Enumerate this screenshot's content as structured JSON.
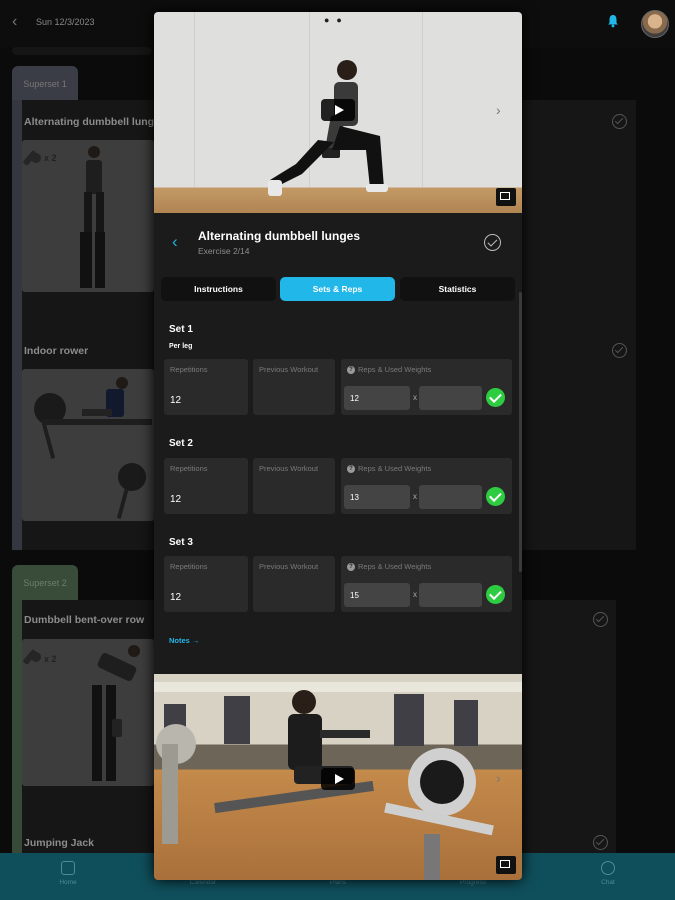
{
  "background": {
    "date": "Sun 12/3/2023",
    "superset1": {
      "label": "Superset 1",
      "exercises": [
        {
          "title": "Alternating dumbbell lunges",
          "badge": "x 2"
        },
        {
          "title": "Indoor rower"
        }
      ]
    },
    "superset2": {
      "label": "Superset 2",
      "exercises": [
        {
          "title": "Dumbbell bent-over row",
          "badge": "x 2"
        },
        {
          "title": "Jumping Jack"
        }
      ]
    },
    "nav": [
      "Home",
      "Calendar",
      "Plans",
      "Progress",
      "Chat"
    ]
  },
  "modal": {
    "title": "Alternating dumbbell lunges",
    "subtitle": "Exercise 2/14",
    "tabs": [
      "Instructions",
      "Sets & Reps",
      "Statistics"
    ],
    "active_tab": "Sets & Reps",
    "per_leg": "Per leg",
    "labels": {
      "repetitions": "Repetitions",
      "previous": "Previous Workout",
      "reps_weights": "Reps & Used Weights",
      "x": "x"
    },
    "sets": [
      {
        "title": "Set 1",
        "reps": "12",
        "used_reps": "12"
      },
      {
        "title": "Set 2",
        "reps": "12",
        "used_reps": "13"
      },
      {
        "title": "Set 3",
        "reps": "12",
        "used_reps": "15"
      }
    ],
    "notes": "Notes →"
  },
  "colors": {
    "accent": "#21b7e8",
    "success": "#2ecc40",
    "nav_bg": "#0f4f5b"
  }
}
